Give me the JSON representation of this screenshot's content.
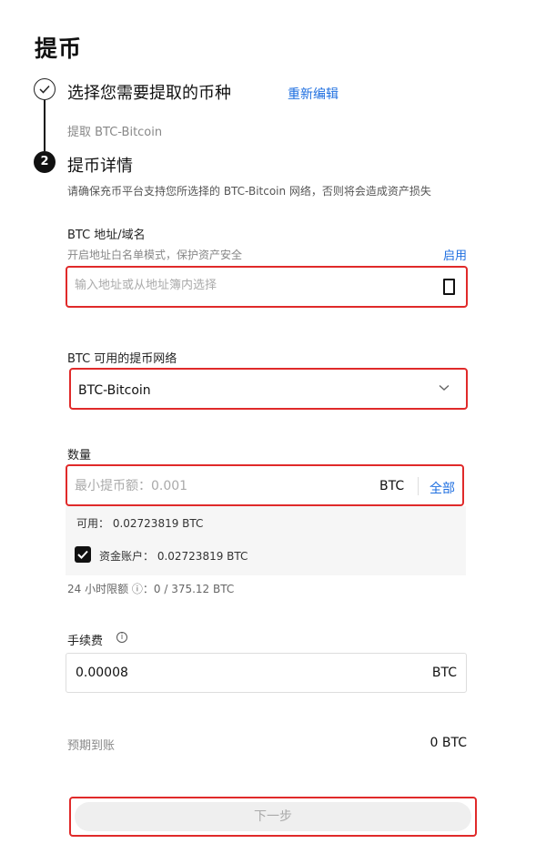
{
  "page": {
    "title": "提币"
  },
  "step1": {
    "title": "选择您需要提取的币种",
    "reedit_label": "重新编辑",
    "selected": "提取 BTC-Bitcoin"
  },
  "step2": {
    "number": "2",
    "title": "提币详情",
    "desc": "请确保充币平台支持您所选择的 BTC-Bitcoin 网络，否则将会造成资产损失"
  },
  "address": {
    "label": "BTC 地址/域名",
    "hint": "开启地址白名单模式，保护资产安全",
    "enable_label": "启用",
    "placeholder": "输入地址或从地址簿内选择",
    "icon": "address-book-icon"
  },
  "network": {
    "label": "BTC 可用的提币网络",
    "selected": "BTC-Bitcoin",
    "icon": "chevron-down-icon"
  },
  "amount": {
    "label": "数量",
    "placeholder": "最小提币额：0.001",
    "unit": "BTC",
    "all_label": "全部",
    "available": "可用： 0.02723819 BTC",
    "fund_account": "资金账户： 0.02723819 BTC",
    "fund_checked": true,
    "limit": "24 小时限额 ⓘ：0 / 375.12 BTC"
  },
  "fee": {
    "label": "手续费",
    "value": "0.00008",
    "unit": "BTC"
  },
  "expected": {
    "label": "预期到账",
    "value": "0 BTC"
  },
  "next_button": {
    "label": "下一步"
  },
  "colors": {
    "accent": "#1f6fe0",
    "highlight_border": "#e02a2a"
  }
}
